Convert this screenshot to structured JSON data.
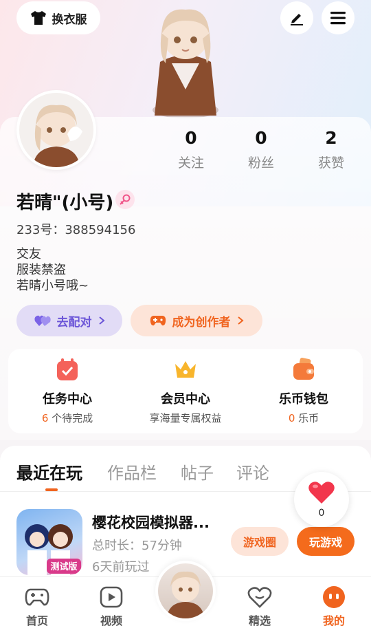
{
  "header": {
    "outfit_button_label": "换衣服",
    "icons": [
      "shirt-icon",
      "edit-icon",
      "menu-icon"
    ]
  },
  "profile": {
    "stats": [
      {
        "value": "0",
        "label": "关注"
      },
      {
        "value": "0",
        "label": "粉丝"
      },
      {
        "value": "2",
        "label": "获赞"
      }
    ],
    "name": "若晴\"(小号)",
    "gender_icon": "female-icon",
    "uid": "233号：388594156",
    "bio": [
      "交友",
      "服装禁盗",
      "若晴小号哦~"
    ],
    "match_button": "去配对",
    "creator_button": "成为创作者"
  },
  "features": [
    {
      "title": "任务中心",
      "count": "6",
      "suffix": " 个待完成",
      "icon": "calendar-check-icon"
    },
    {
      "title": "会员中心",
      "subtitle": "享海量专属权益",
      "icon": "crown-icon"
    },
    {
      "title": "乐币钱包",
      "count": "0",
      "suffix": " 乐币",
      "icon": "wallet-icon"
    }
  ],
  "tabs": [
    "最近在玩",
    "作品栏",
    "帖子",
    "评论"
  ],
  "recent_game": {
    "title": "樱花校园模拟器...",
    "duration": "总时长：57分钟",
    "last_played": "6天前玩过",
    "badge": "测试版",
    "circle_button": "游戏圈",
    "play_button": "玩游戏"
  },
  "like_bubble": {
    "count": "0"
  },
  "bottom_nav": [
    {
      "label": "首页",
      "icon": "gamepad-icon"
    },
    {
      "label": "视频",
      "icon": "play-icon"
    },
    {
      "label": "精选",
      "icon": "heart-outline-icon"
    },
    {
      "label": "我的",
      "icon": "face-icon",
      "active": true
    }
  ],
  "colors": {
    "accent": "#f0641f",
    "purple": "#6c56d8",
    "like": "#f2364c"
  }
}
